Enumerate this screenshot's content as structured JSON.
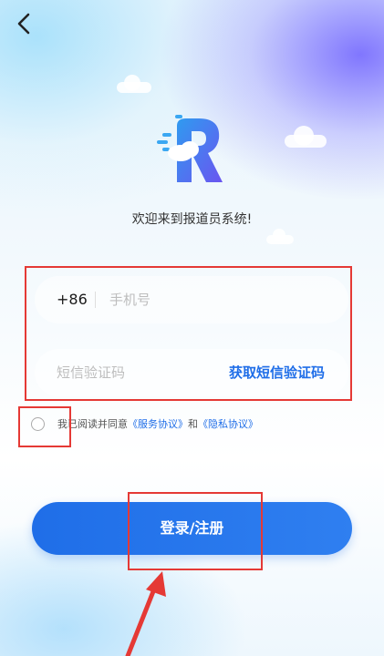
{
  "nav": {
    "back_icon": "chevron-left-icon"
  },
  "logo": {
    "icon": "app-logo-r-icon"
  },
  "welcome_text": "欢迎来到报道员系统!",
  "phone": {
    "prefix": "+86",
    "placeholder": "手机号"
  },
  "code": {
    "placeholder": "短信验证码",
    "get_code_label": "获取短信验证码"
  },
  "agreement": {
    "text_prefix": "我已阅读并同意",
    "service_link": "《服务协议》",
    "and": "和",
    "privacy_link": "《隐私协议》",
    "checked": false
  },
  "submit_label": "登录/注册",
  "colors": {
    "accent": "#1f6ee8",
    "highlight": "#e53935"
  }
}
